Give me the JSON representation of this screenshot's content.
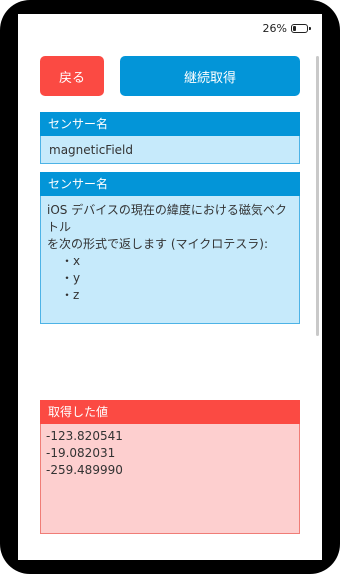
{
  "status": {
    "battery_text": "26%",
    "battery_level": 0.26
  },
  "toolbar": {
    "back_label": "戻る",
    "continue_label": "継続取得"
  },
  "sensor_name_panel": {
    "header": "センサー名",
    "value": "magneticField"
  },
  "description_panel": {
    "header": "センサー名",
    "lines": [
      "iOS デバイスの現在の緯度における磁気ベクトル",
      "を次の形式で返します (マイクロテスラ):"
    ],
    "bullets": [
      "・x",
      "・y",
      "・z"
    ]
  },
  "result_panel": {
    "header": "取得した値",
    "values": [
      "-123.820541",
      "-19.082031",
      "-259.489990"
    ]
  },
  "colors": {
    "blue": "#0395d8",
    "light_blue": "#c6eafb",
    "red": "#fb4a43",
    "light_red": "#fdcfcf"
  }
}
